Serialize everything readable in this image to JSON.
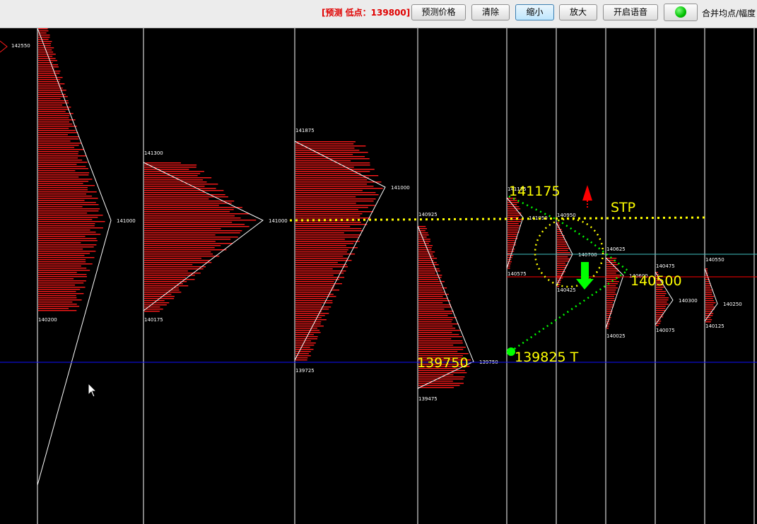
{
  "toolbar": {
    "forecast_label": "[预测 低点：139800]",
    "buttons": [
      {
        "id": "predict-price",
        "label": "预测价格"
      },
      {
        "id": "clear",
        "label": "清除"
      },
      {
        "id": "zoom-out",
        "label": "缩小"
      },
      {
        "id": "zoom-in",
        "label": "放大"
      },
      {
        "id": "voice",
        "label": "开启语音"
      }
    ],
    "merge_label": "合并均点/幅度"
  },
  "colors": {
    "background": "#000000",
    "grid": "#ffffff",
    "profile": "#ff1a1a",
    "annotation": "#ffff00",
    "signal": "#00ff00",
    "low_line": "#0000ff",
    "red_line": "#ff0000",
    "cyan_line": "#3fbfbf"
  },
  "chart_data": {
    "type": "market-profile",
    "profiles": [
      {
        "high": "142550",
        "low": "",
        "peak": ""
      },
      {
        "high": "",
        "low": "140200",
        "peak": "141000"
      },
      {
        "high": "141300",
        "low": "140175",
        "peak": "141000"
      },
      {
        "high": "141875",
        "low": "139725",
        "peak": "141000"
      },
      {
        "high": "140925",
        "low": "139475",
        "peak": "139750"
      },
      {
        "high": "141175",
        "low": "140575",
        "peak": "141050"
      },
      {
        "high": "140950",
        "low": "140425",
        "peak": "140700"
      },
      {
        "high": "140625",
        "low": "140025",
        "peak": "140600"
      },
      {
        "high": "140475",
        "low": "140075",
        "peak": "140300"
      },
      {
        "high": "140550",
        "low": "140125",
        "peak": "140250"
      }
    ],
    "annotations": {
      "high_target": "141175",
      "stop_label": "STP",
      "mid_target": "140500",
      "low_left": "139750",
      "low_target": "139825 T"
    },
    "horizontal_lines": {
      "dotted_yellow": "141000",
      "blue": "139750"
    }
  }
}
